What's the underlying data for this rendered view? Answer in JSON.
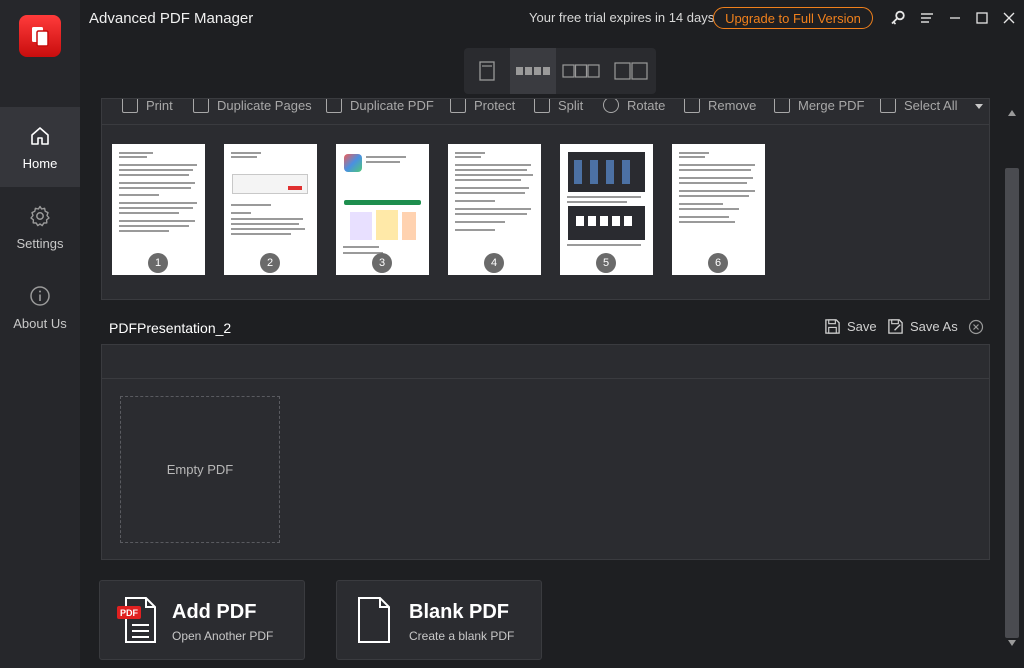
{
  "app": {
    "title": "Advanced PDF Manager",
    "trial_text": "Your free trial expires in 14 days",
    "upgrade_label": "Upgrade to Full Version",
    "accent": "#f0801c"
  },
  "sidebar": {
    "items": [
      {
        "label": "Home",
        "icon": "home-icon",
        "active": true
      },
      {
        "label": "Settings",
        "icon": "gear-icon",
        "active": false
      },
      {
        "label": "About Us",
        "icon": "info-icon",
        "active": false
      }
    ]
  },
  "toolbar": {
    "actions": [
      {
        "label": "Print",
        "icon": "printer-icon"
      },
      {
        "label": "Duplicate Pages",
        "icon": "duplicate-pages-icon"
      },
      {
        "label": "Duplicate PDF",
        "icon": "duplicate-pdf-icon"
      },
      {
        "label": "Protect",
        "icon": "lock-icon"
      },
      {
        "label": "Split",
        "icon": "split-icon"
      },
      {
        "label": "Rotate",
        "icon": "rotate-icon"
      },
      {
        "label": "Remove",
        "icon": "remove-icon"
      },
      {
        "label": "Merge PDF",
        "icon": "merge-icon"
      },
      {
        "label": "Select All",
        "icon": "select-all-icon"
      }
    ]
  },
  "pages": [
    "1",
    "2",
    "3",
    "4",
    "5",
    "6"
  ],
  "document": {
    "name": "PDFPresentation_2",
    "save_label": "Save",
    "save_as_label": "Save As",
    "empty_label": "Empty PDF"
  },
  "actions": {
    "add_pdf": {
      "title": "Add PDF",
      "subtitle": "Open Another PDF",
      "badge": "PDF"
    },
    "blank_pdf": {
      "title": "Blank PDF",
      "subtitle": "Create a blank PDF"
    }
  }
}
